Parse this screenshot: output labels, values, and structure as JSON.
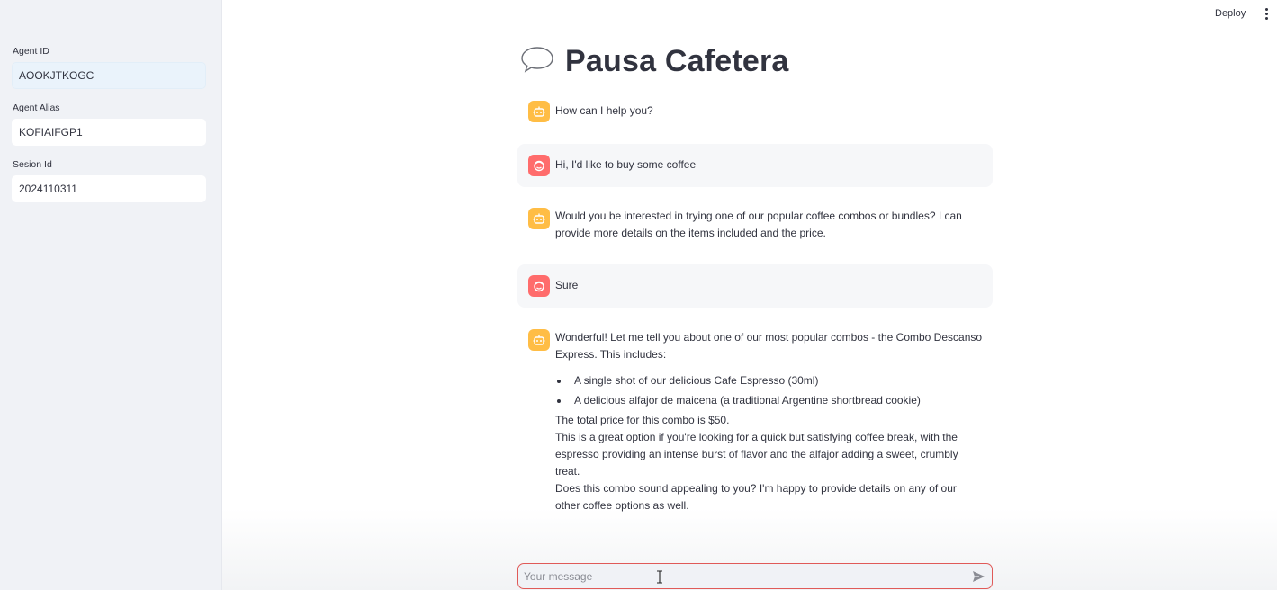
{
  "header": {
    "deploy_label": "Deploy",
    "menu_icon": "kebab-menu-icon"
  },
  "sidebar": {
    "fields": [
      {
        "label": "Agent ID",
        "value": "AOOKJTKOGC"
      },
      {
        "label": "Agent Alias",
        "value": "KOFIAIFGP1"
      },
      {
        "label": "Sesion Id",
        "value": "2024110311"
      }
    ]
  },
  "main": {
    "title": "Pausa Cafetera",
    "title_icon": "speech-bubble-icon",
    "messages": [
      {
        "role": "assistant",
        "text": "How can I help you?"
      },
      {
        "role": "user",
        "text": "Hi, I'd like to buy some coffee"
      },
      {
        "role": "assistant",
        "text": "Would you be interested in trying one of our popular coffee combos or bundles? I can provide more details on the items included and the price."
      },
      {
        "role": "user",
        "text": "Sure"
      },
      {
        "role": "assistant",
        "intro": "Wonderful! Let me tell you about one of our most popular combos - the Combo Descanso Express. This includes:",
        "bullets": [
          "A single shot of our delicious Cafe Espresso (30ml)",
          "A delicious alfajor de maicena (a traditional Argentine shortbread cookie)"
        ],
        "paragraphs": [
          "The total price for this combo is $50.",
          "This is a great option if you're looking for a quick but satisfying coffee break, with the espresso providing an intense burst of flavor and the alfajor adding a sweet, crumbly treat.",
          "Does this combo sound appealing to you? I'm happy to provide details on any of our other coffee options as well."
        ]
      }
    ]
  },
  "chat_input": {
    "placeholder": "Your message",
    "value": "",
    "send_icon": "send-arrow-icon"
  },
  "colors": {
    "sidebar_bg": "#f0f2f6",
    "assistant_avatar": "#ffbd45",
    "user_avatar": "#ff6c6c",
    "input_border": "#e05a58",
    "text": "#31333f"
  }
}
